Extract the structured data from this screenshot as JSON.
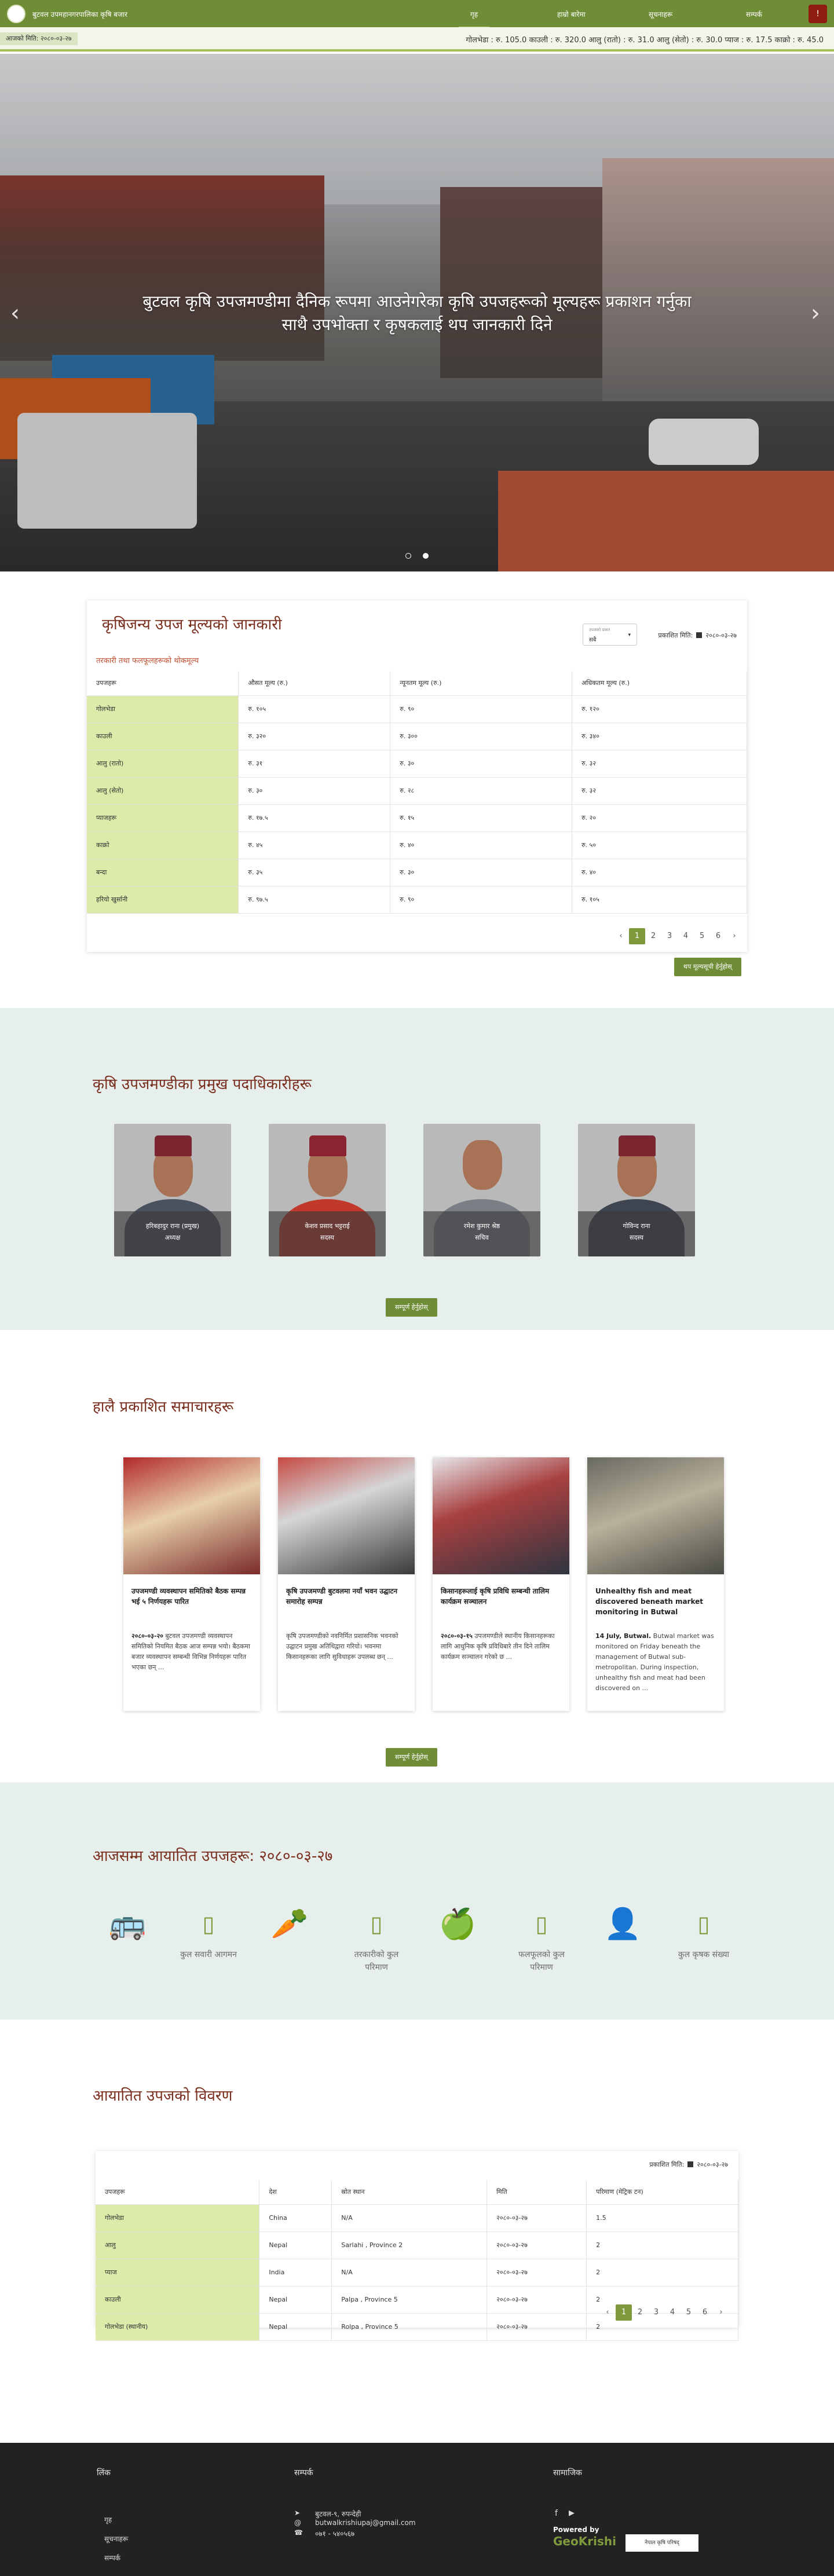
{
  "nav": {
    "brand": "बुटवल उपमहानगरपालिका कृषि बजार",
    "items": [
      "गृह",
      "हाम्रो बारेमा",
      "सूचनाहरू",
      "सम्पर्क"
    ],
    "user_icon": "!"
  },
  "ticker": {
    "date": "आजको मिति: २०८०-०३-२७",
    "text": "गोलभेडा : रु. 105.0  काउली : रु. 320.0  आलु (रातो) : रु. 31.0  आलु (सेतो) : रु. 30.0  प्याज : रु. 17.5  काक्रो : रु. 45.0"
  },
  "hero": {
    "caption": "बुटवल कृषि उपजमण्डीमा दैनिक रूपमा आउनेगरेका कृषि उपजहरूको मूल्यहरू प्रकाशन गर्नुका साथै उपभोक्ता र कृषकलाई थप जानकारी दिने",
    "prev": "‹",
    "next": "›"
  },
  "prices": {
    "title": "कृषिजन्य उपज मूल्यको जानकारी",
    "subtitle": "तरकारी तथा फलफूलहरूको थोकमूल्य",
    "select_label": "उपजको प्रकार",
    "select_value": "सबै",
    "date_label": "प्रकाशित मिति:",
    "date_value": "२०८०-०३-२७",
    "headers": [
      "उपजहरू",
      "औसत मूल्य (रु.)",
      "न्यूनतम मूल्य (रु.)",
      "अधिकतम मूल्य (रु.)"
    ],
    "rows": [
      [
        "गोलभेडा",
        "रु. १०५",
        "रु. ९०",
        "रु. १२०"
      ],
      [
        "काउली",
        "रु. ३२०",
        "रु. ३००",
        "रु. ३४०"
      ],
      [
        "आलु (रातो)",
        "रु. ३१",
        "रु. ३०",
        "रु. ३२"
      ],
      [
        "आलु (सेतो)",
        "रु. ३०",
        "रु. २८",
        "रु. ३२"
      ],
      [
        "प्याजहरू",
        "रु. १७.५",
        "रु. १५",
        "रु. २०"
      ],
      [
        "काक्रो",
        "रु. ४५",
        "रु. ४०",
        "रु. ५०"
      ],
      [
        "बन्दा",
        "रु. ३५",
        "रु. ३०",
        "रु. ४०"
      ],
      [
        "हरियो खुर्सानी",
        "रु. ९७.५",
        "रु. ९०",
        "रु. १०५"
      ]
    ],
    "pages": [
      "‹",
      "1",
      "2",
      "3",
      "4",
      "5",
      "6",
      "›"
    ],
    "more": "थप मूल्यसूची हेर्नुहोस्"
  },
  "officials": {
    "title": "कृषि उपजमण्डीका प्रमुख पदाधिकारीहरू",
    "people": [
      {
        "name": "हरिबहादुर राना (प्रमुख)",
        "role": "अध्यक्ष"
      },
      {
        "name": "केशव प्रसाद भट्टराई",
        "role": "सदस्य"
      },
      {
        "name": "रमेश कुमार श्रेष्ठ",
        "role": "सचिव"
      },
      {
        "name": "गोविन्द राना",
        "role": "सदस्य"
      }
    ],
    "more": "सम्पूर्ण हेर्नुहोस्"
  },
  "news": {
    "title": "हालै प्रकाशित समाचारहरू",
    "items": [
      {
        "headline": "उपजमण्डी व्यवस्थापन समितिको बैठक सम्पन्न भई ५ निर्णयहरू पारित",
        "date": "२०८०-०३-२०",
        "body": "बुटवल उपजमण्डी व्यवस्थापन समितिको नियमित बैठक आज सम्पन्न भयो। बैठकमा बजार व्यवस्थापन सम्बन्धी विभिन्न निर्णयहरू पारित भएका छन् ..."
      },
      {
        "headline": "कृषि उपजमण्डी बुटवलमा नयाँ भवन उद्घाटन समारोह सम्पन्न",
        "date": "",
        "body": "कृषि उपजमण्डीको नवनिर्मित प्रशासनिक भवनको उद्घाटन प्रमुख अतिथिद्वारा गरियो। भवनमा किसानहरूका लागि सुविधाहरू उपलब्ध छन् ..."
      },
      {
        "headline": "किसानहरूलाई कृषि प्रविधि सम्बन्धी तालिम कार्यक्रम सञ्चालन",
        "date": "२०८०-०३-१५",
        "body": "उपजमण्डीले स्थानीय किसानहरूका लागि आधुनिक कृषि प्रविधिबारे तीन दिने तालिम कार्यक्रम सञ्चालन गरेको छ ..."
      },
      {
        "headline": "Unhealthy fish and meat discovered beneath market monitoring in Butwal",
        "date": "14 July, Butwal.",
        "body": "Butwal market was monitored on Friday beneath the management of Butwal sub-metropolitan. During inspection, unhealthy fish and meat had been discovered on ..."
      }
    ],
    "more": "सम्पूर्ण हेर्नुहोस्"
  },
  "categories": {
    "title": "आजसम्म आयातित उपजहरू: २०८०-०३-२७",
    "items": [
      {
        "icon": "truck-icon",
        "glyph": "🚌",
        "label": "कुल सवारी आगमन"
      },
      {
        "icon": "box-icon",
        "glyph": "▯",
        "label": ""
      },
      {
        "icon": "carrot-icon",
        "glyph": "🥕",
        "label": "तरकारीको कुल परिमाण"
      },
      {
        "icon": "box-icon",
        "glyph": "▯",
        "label": ""
      },
      {
        "icon": "apple-icon",
        "glyph": "🍏",
        "label": "फलफूलको कुल परिमाण"
      },
      {
        "icon": "box-icon",
        "glyph": "▯",
        "label": ""
      },
      {
        "icon": "user-icon",
        "glyph": "👤",
        "label": "कुल कृषक संख्या"
      },
      {
        "icon": "box-icon",
        "glyph": "▯",
        "label": ""
      }
    ],
    "stats": [
      "०",
      "०",
      "०",
      "०"
    ]
  },
  "imports": {
    "title": "आयातित उपजको विवरण",
    "date_label": "प्रकाशित मिति:",
    "date_value": "२०८०-०३-२७",
    "headers": [
      "उपजहरू",
      "देश",
      "स्रोत स्थान",
      "मिति",
      "परिमाण (मेट्रिक टन)"
    ],
    "rows": [
      [
        "गोलभेडा",
        "China",
        "N/A",
        "२०८०-०३-२७",
        "1.5"
      ],
      [
        "आलु",
        "Nepal",
        "Sarlahi , Province 2",
        "२०८०-०३-२७",
        "2"
      ],
      [
        "प्याज",
        "India",
        "N/A",
        "२०८०-०३-२७",
        "2"
      ],
      [
        "काउली",
        "Nepal",
        "Palpa , Province 5",
        "२०८०-०३-२७",
        "2"
      ],
      [
        "गोलभेडा (स्थानीय)",
        "Nepal",
        "Rolpa , Province 5",
        "२०८०-०३-२७",
        "2"
      ]
    ],
    "pages": [
      "‹",
      "1",
      "2",
      "3",
      "4",
      "5",
      "6",
      "›"
    ]
  },
  "footer": {
    "col1_title": "लिंक",
    "col1_links": [
      "गृह",
      "सूचनाहरू",
      "सम्पर्क"
    ],
    "col2_title": "सम्पर्क",
    "address": "बुटवल-९, रुपन्देही",
    "email": "butwalkrishiupaj@gmail.com",
    "phone": "०७१ - ५४०५६७",
    "col3_title": "सामाजिक",
    "powered": "Powered by",
    "gk_text": "GeoKrishi",
    "partner": "नेपाल कृषि परिषद्"
  },
  "colors": {
    "brand_green": "#6f8d37",
    "accent_red": "#8f1c10",
    "title_brown": "#7a2e1e",
    "light_green_cell": "#dbeba9"
  }
}
